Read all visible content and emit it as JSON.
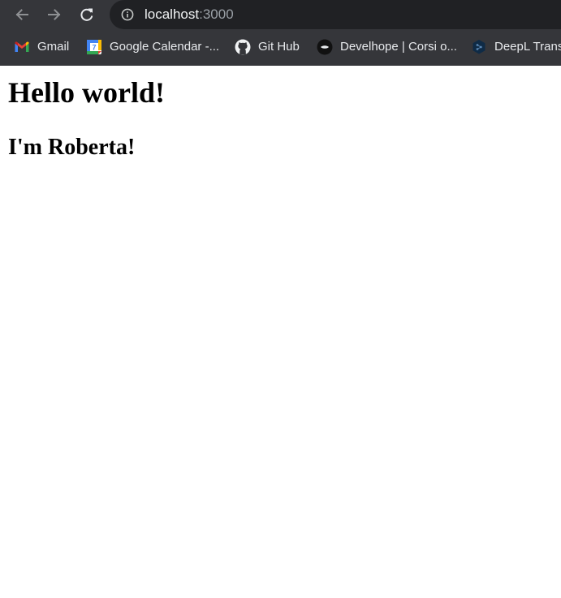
{
  "browser": {
    "url_host": "localhost",
    "url_port": ":3000",
    "icons": {
      "back": "back-arrow-icon",
      "forward": "forward-arrow-icon",
      "reload": "reload-icon",
      "site_info": "info-icon"
    }
  },
  "bookmarks": [
    {
      "label": "Gmail",
      "icon": "gmail-icon"
    },
    {
      "label": "Google Calendar -...",
      "icon": "calendar-icon",
      "icon_text": "7"
    },
    {
      "label": "Git Hub",
      "icon": "github-icon"
    },
    {
      "label": "Develhope | Corsi o...",
      "icon": "develhope-icon"
    },
    {
      "label": "DeepL Trans",
      "icon": "deepl-icon"
    }
  ],
  "page": {
    "heading1": "Hello world!",
    "heading2": "I'm Roberta!"
  },
  "colors": {
    "chrome_bg": "#35363a",
    "omnibox_bg": "#202124",
    "page_bg": "#ffffff"
  }
}
